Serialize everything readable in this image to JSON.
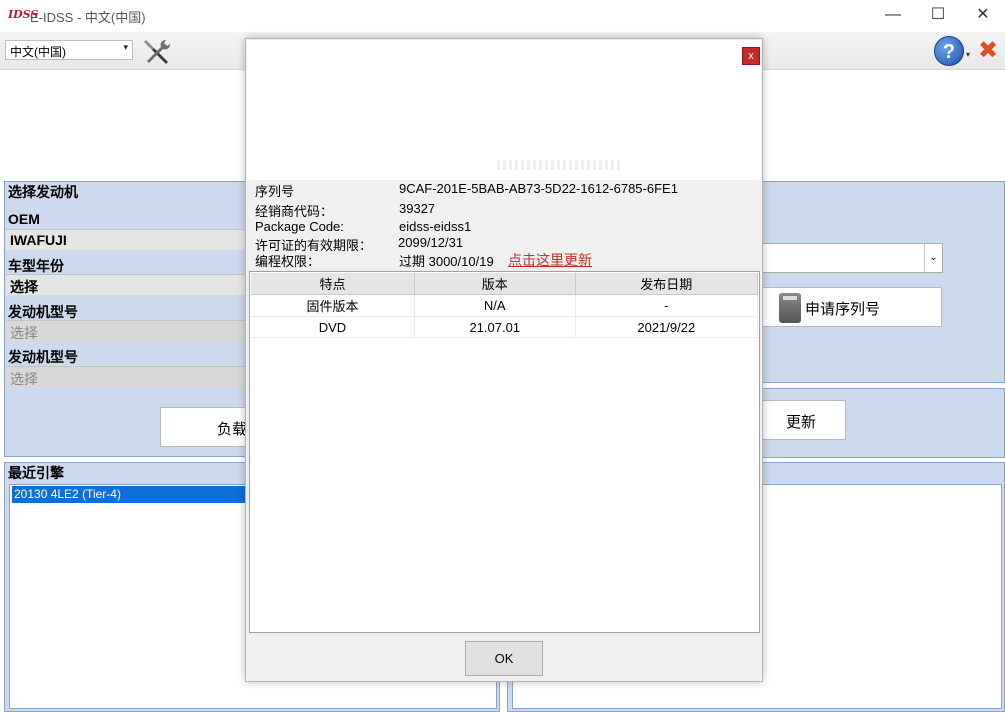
{
  "window": {
    "logo": "IDSS",
    "title": "E-IDSS - 中文(中国)",
    "minimize": "—",
    "maximize": "☐",
    "close": "✕"
  },
  "toolbar": {
    "language": "中文(中国)",
    "language_arrow": "▾",
    "help": "?",
    "help_caret": "▾",
    "exit": "✖"
  },
  "engine_panel": {
    "title": "选择发动机",
    "oem_label": "OEM",
    "oem_value": "IWAFUJI",
    "year_label": "车型年份",
    "year_value": "选择",
    "model1_label": "发动机型号",
    "model1_value": "选择",
    "model2_label": "发动机型号",
    "model2_value": "选择",
    "load_button": "负载"
  },
  "recent": {
    "title": "最近引擎",
    "items": [
      "20130 4LE2 (Tier-4)"
    ]
  },
  "right_panel": {
    "dropdown_arrow": "⌄",
    "serial_button": "申请序列号",
    "update_button": "更新"
  },
  "dialog": {
    "close": "x",
    "serial_label": "序列号",
    "serial_value": "9CAF-201E-5BAB-AB73-5D22-1612-6785-6FE1",
    "dealer_label": "经销商代码：",
    "dealer_value": "39327",
    "package_label": "Package Code:",
    "package_value": "eidss-eidss1",
    "license_label": "许可证的有效期限：",
    "license_value": "2099/12/31",
    "program_label": "编程权限：",
    "program_value": "过期 3000/10/19",
    "renew_link": "点击这里更新",
    "table": {
      "headers": [
        "特点",
        "版本",
        "发布日期"
      ],
      "rows": [
        [
          "固件版本",
          "N/A",
          "-"
        ],
        [
          "DVD",
          "21.07.01",
          "2021/9/22"
        ]
      ]
    },
    "ok_button": "OK"
  }
}
